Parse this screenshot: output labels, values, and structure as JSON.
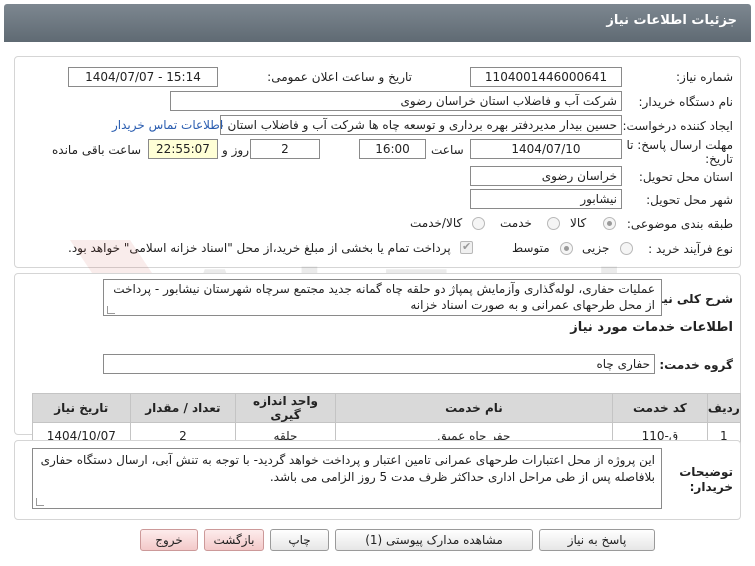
{
  "header": {
    "title": "جزئیات اطلاعات نیاز"
  },
  "form": {
    "need_number_label": "شماره نیاز:",
    "need_number": "1104001446000641",
    "announce_label": "تاریخ و ساعت اعلان عمومی:",
    "announce_value": "1404/07/07 - 15:14",
    "buyer_org_label": "نام دستگاه خریدار:",
    "buyer_org": "شرکت آب و فاضلاب استان خراسان رضوی",
    "creator_label": "ایجاد کننده درخواست:",
    "creator": "حسین  بیدار مدیردفتر بهره برداری و توسعه چاه ها شرکت آب و فاضلاب استان خراسان رضوی",
    "contact_link": "اطلاعات تماس خریدار",
    "deadline_label_line1": "مهلت ارسال پاسخ: تا",
    "deadline_label_line2": "تاریخ:",
    "deadline_date": "1404/07/10",
    "time_label": "ساعت",
    "deadline_time": "16:00",
    "days_value": "2",
    "days_label": "روز و",
    "remaining_time": "22:55:07",
    "remaining_label": "ساعت باقی مانده",
    "province_label": "استان محل تحویل:",
    "province": "خراسان رضوی",
    "city_label": "شهر محل تحویل:",
    "city": "نیشابور",
    "category_label": "طبقه بندی موضوعی:",
    "category_options": [
      "کالا",
      "خدمت",
      "کالا/خدمت"
    ],
    "category_selected": 0,
    "process_label": "نوع فرآیند خرید :",
    "process_options": [
      "جزیی",
      "متوسط"
    ],
    "process_selected": 1,
    "payment_note": "پرداخت تمام یا بخشی از مبلغ خرید،از محل \"اسناد خزانه اسلامی\" خواهد بود."
  },
  "description": {
    "label": "شرح کلی نیاز:",
    "text": "عملیات حفاری، لوله‌گذاری وآزمایش پمپاژ دو حلقه چاه گمانه جدید مجتمع سرچاه شهرستان نیشابور - پرداخت از محل طرحهای عمرانی و به صورت اسناد خزانه"
  },
  "services": {
    "section_title": "اطلاعات خدمات مورد نیاز",
    "group_label": "گروه خدمت:",
    "group_value": "حفاری چاه",
    "table": {
      "headers": [
        "ردیف",
        "کد خدمت",
        "نام خدمت",
        "واحد اندازه گیری",
        "تعداد / مقدار",
        "تاریخ نیاز"
      ],
      "rows": [
        [
          "1",
          "ق-110",
          "حفر چاه عمیق",
          "حلقه",
          "2",
          "1404/10/07"
        ]
      ]
    }
  },
  "buyer_notes": {
    "label_line1": "توضیحات",
    "label_line2": "خریدار:",
    "text": "این پروژه از محل اعتبارات طرحهای عمرانی تامین اعتبار و پرداخت خواهد گردید- با توجه به تنش آبی، ارسال دستگاه حفاری بلافاصله پس از طی مراحل اداری حداکثر ظرف مدت 5 روز الزامی می باشد."
  },
  "buttons": {
    "reply": "پاسخ به نیاز",
    "attachments": "مشاهده مدارک پیوستی (1)",
    "print": "چاپ",
    "back": "بازگشت",
    "exit": "خروج"
  },
  "watermark": "AriaTender.net",
  "colors": {
    "header": "#6e7881",
    "link": "#2a5db0",
    "table_header": "#d9d9d9"
  }
}
